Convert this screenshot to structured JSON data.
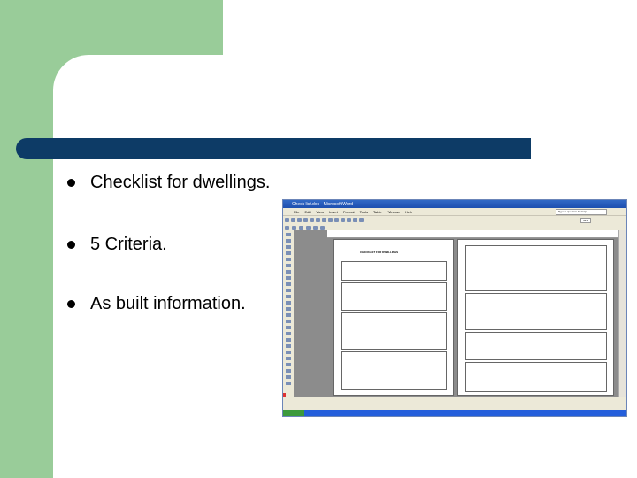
{
  "slide": {
    "bullets": [
      "Checklist for dwellings.",
      "5 Criteria.",
      "As built information."
    ]
  },
  "word_window": {
    "title": "Check list.doc - Microsoft Word",
    "menu": [
      "File",
      "Edit",
      "View",
      "Insert",
      "Format",
      "Tools",
      "Table",
      "Window",
      "Help"
    ],
    "help_box": "Type a question for help",
    "zoom": "43%",
    "page1_heading": "CHECKLIST FOR DWELLINGS"
  },
  "colors": {
    "accent_green": "#99cc99",
    "title_bar_navy": "#0d3b66"
  }
}
